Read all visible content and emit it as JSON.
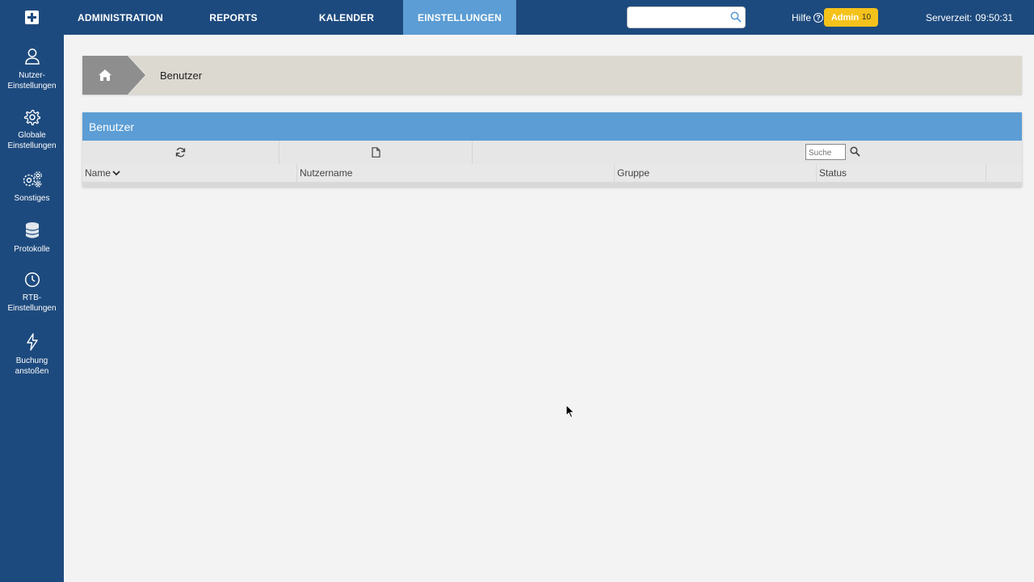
{
  "topbar": {
    "nav": [
      {
        "label": "ADMINISTRATION",
        "active": false
      },
      {
        "label": "REPORTS",
        "active": false
      },
      {
        "label": "KALENDER",
        "active": false
      },
      {
        "label": "EINSTELLUNGEN",
        "active": true
      }
    ],
    "search": {
      "value": "",
      "placeholder": ""
    },
    "help_label": "Hilfe",
    "user_badge": {
      "label": "Admin",
      "count": "10"
    },
    "servertime_label": "Serverzeit:",
    "servertime_value": "09:50:31"
  },
  "sidebar": {
    "items": [
      {
        "line1": "Nutzer-",
        "line2": "Einstellungen",
        "icon": "user-icon"
      },
      {
        "line1": "Globale",
        "line2": "Einstellungen",
        "icon": "gear-icon"
      },
      {
        "line1": "Sonstiges",
        "line2": "",
        "icon": "gears-icon"
      },
      {
        "line1": "Protokolle",
        "line2": "",
        "icon": "database-icon"
      },
      {
        "line1": "RTB-",
        "line2": "Einstellungen",
        "icon": "clock-icon"
      },
      {
        "line1": "Buchung",
        "line2": "anstoßen",
        "icon": "lightning-icon"
      }
    ]
  },
  "breadcrumb": {
    "current": "Benutzer"
  },
  "panel": {
    "title": "Benutzer",
    "search_placeholder": "Suche",
    "columns": [
      "Name",
      "Nutzername",
      "Gruppe",
      "Status"
    ]
  },
  "colors": {
    "bar": "#1d4a7e",
    "accent": "#5b9dd4",
    "badge": "#f5c21b"
  }
}
